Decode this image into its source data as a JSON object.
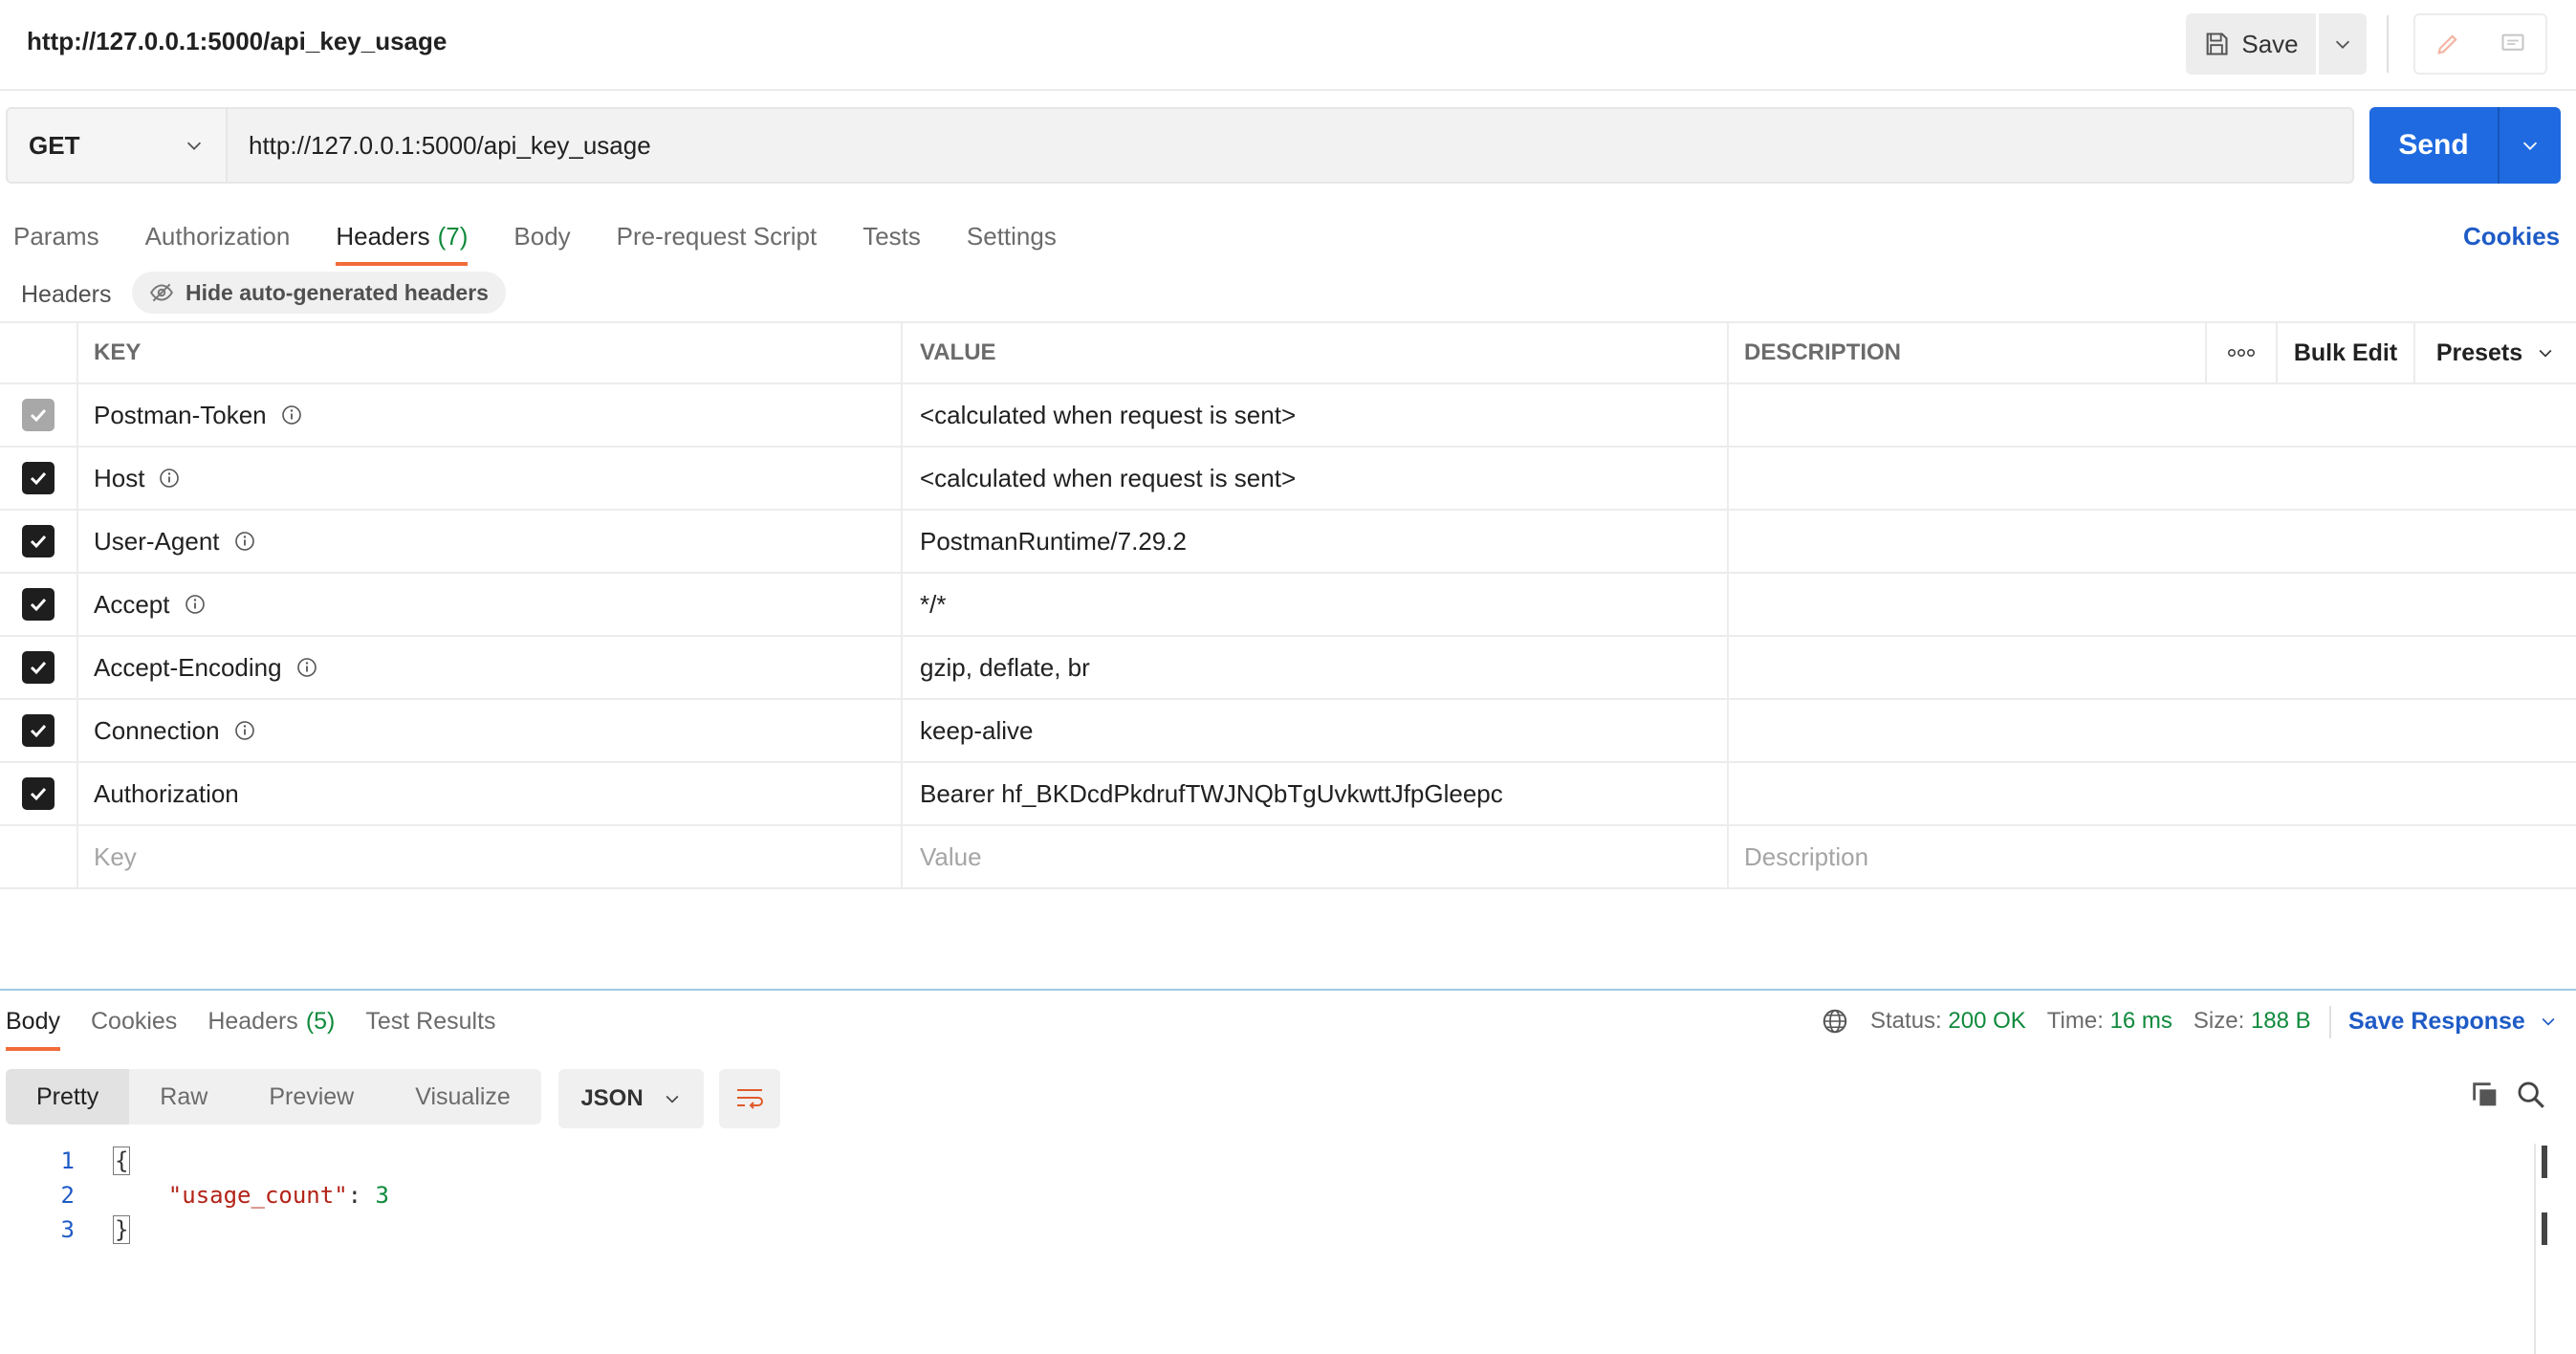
{
  "request": {
    "title": "http://127.0.0.1:5000/api_key_usage",
    "method": "GET",
    "url": "http://127.0.0.1:5000/api_key_usage",
    "save_label": "Save",
    "send_label": "Send"
  },
  "req_tabs": [
    {
      "label": "Params"
    },
    {
      "label": "Authorization"
    },
    {
      "label": "Headers",
      "count": "(7)"
    },
    {
      "label": "Body"
    },
    {
      "label": "Pre-request Script"
    },
    {
      "label": "Tests"
    },
    {
      "label": "Settings"
    }
  ],
  "cookies_link": "Cookies",
  "headers_section": {
    "label": "Headers",
    "hide_auto_label": "Hide auto-generated headers"
  },
  "table": {
    "columns": {
      "key": "KEY",
      "value": "VALUE",
      "description": "DESCRIPTION"
    },
    "more_icon": "more-icon",
    "bulk_edit": "Bulk Edit",
    "presets": "Presets",
    "rows": [
      {
        "key": "Postman-Token",
        "value": "<calculated when request is sent>",
        "checked": true,
        "disabled": true,
        "info": true
      },
      {
        "key": "Host",
        "value": "<calculated when request is sent>",
        "checked": true,
        "disabled": false,
        "info": true
      },
      {
        "key": "User-Agent",
        "value": "PostmanRuntime/7.29.2",
        "checked": true,
        "disabled": false,
        "info": true
      },
      {
        "key": "Accept",
        "value": "*/*",
        "checked": true,
        "disabled": false,
        "info": true
      },
      {
        "key": "Accept-Encoding",
        "value": "gzip, deflate, br",
        "checked": true,
        "disabled": false,
        "info": true
      },
      {
        "key": "Connection",
        "value": "keep-alive",
        "checked": true,
        "disabled": false,
        "info": true
      },
      {
        "key": "Authorization",
        "value": "Bearer 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",
        "checked": true,
        "disabled": false,
        "info": false
      }
    ],
    "placeholders": {
      "key": "Key",
      "value": "Value",
      "description": "Description"
    }
  },
  "response": {
    "tabs": [
      {
        "label": "Body"
      },
      {
        "label": "Cookies"
      },
      {
        "label": "Headers",
        "count": "(5)"
      },
      {
        "label": "Test Results"
      }
    ],
    "status_label": "Status:",
    "status_value": "200 OK",
    "time_label": "Time:",
    "time_value": "16 ms",
    "size_label": "Size:",
    "size_value": "188 B",
    "save_response": "Save Response",
    "formats": [
      "Pretty",
      "Raw",
      "Preview",
      "Visualize"
    ],
    "language": "JSON",
    "code_lines": [
      {
        "num": "1",
        "open": "{"
      },
      {
        "num": "2",
        "key": "\"usage_count\"",
        "sep": ": ",
        "value": "3"
      },
      {
        "num": "3",
        "close": "}"
      }
    ]
  },
  "colors": {
    "accent": "#f26b3a",
    "send": "#1f6ae0",
    "link": "#1e5bc6",
    "success": "#0f8a3c"
  }
}
